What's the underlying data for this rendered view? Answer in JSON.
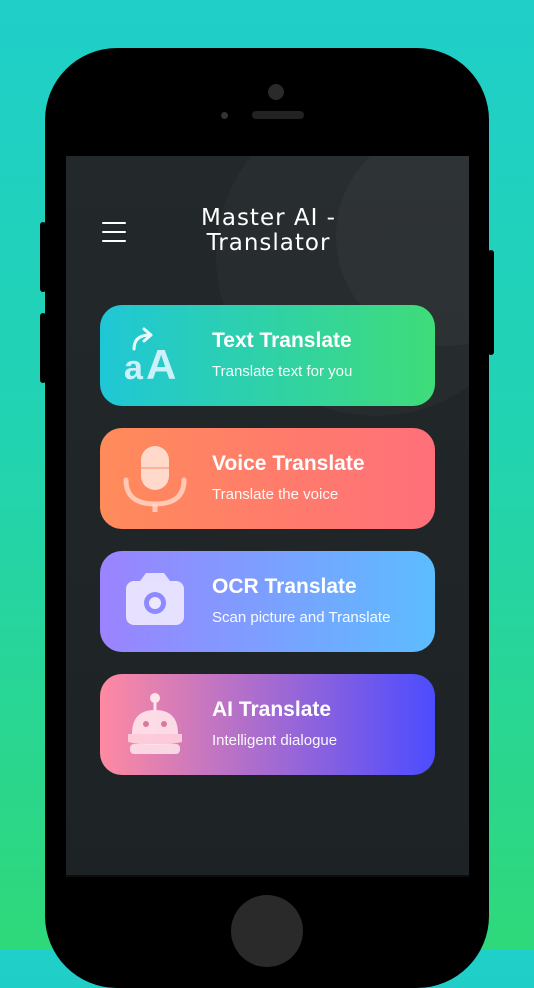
{
  "header": {
    "title": "Master AI - Translator"
  },
  "menu": {
    "icon": "hamburger-menu-icon"
  },
  "features": [
    {
      "label": "Text Translate",
      "description": "Translate text for you",
      "icon": "text-aA-icon"
    },
    {
      "label": "Voice Translate",
      "description": "Translate the voice",
      "icon": "microphone-icon"
    },
    {
      "label": "OCR Translate",
      "description": "Scan picture and Translate",
      "icon": "camera-icon"
    },
    {
      "label": "AI Translate",
      "description": "Intelligent dialogue",
      "icon": "robot-icon"
    }
  ],
  "colors": {
    "background_start": "#1fcfc9",
    "background_end": "#2fd87a",
    "screen": "#23282a",
    "text_card": [
      "#1fc7d6",
      "#3fdc79"
    ],
    "voice_card": [
      "#ff8b5a",
      "#ff6f7a"
    ],
    "ocr_card": [
      "#9b83ff",
      "#5cbcff"
    ],
    "ai_card": [
      "#ff8aa2",
      "#4c4cff"
    ]
  }
}
